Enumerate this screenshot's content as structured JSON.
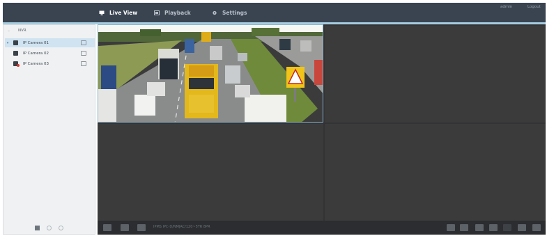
{
  "nav": {
    "live_view": "Live View",
    "playback": "Playback",
    "settings": "Settings"
  },
  "user": {
    "username": "admin",
    "logout": "Logout"
  },
  "sidebar": {
    "root_label": "NVR",
    "cameras": [
      {
        "label": "IP Camera 01",
        "selected": true,
        "status": "live"
      },
      {
        "label": "IP Camera 02",
        "selected": false,
        "status": "idle"
      },
      {
        "label": "IP Camera 03",
        "selected": false,
        "status": "error"
      }
    ]
  },
  "toolbar": {
    "stream_info": "IPMS IPC-D/NMJAC/120~5TR 8PR"
  },
  "colors": {
    "topbar": "#3a4451",
    "accent": "#a6cde1",
    "selected_row": "#cfe3f1",
    "video_bg": "#3b3b3c",
    "toolbar": "#2b2d30",
    "error": "#d9362a"
  }
}
